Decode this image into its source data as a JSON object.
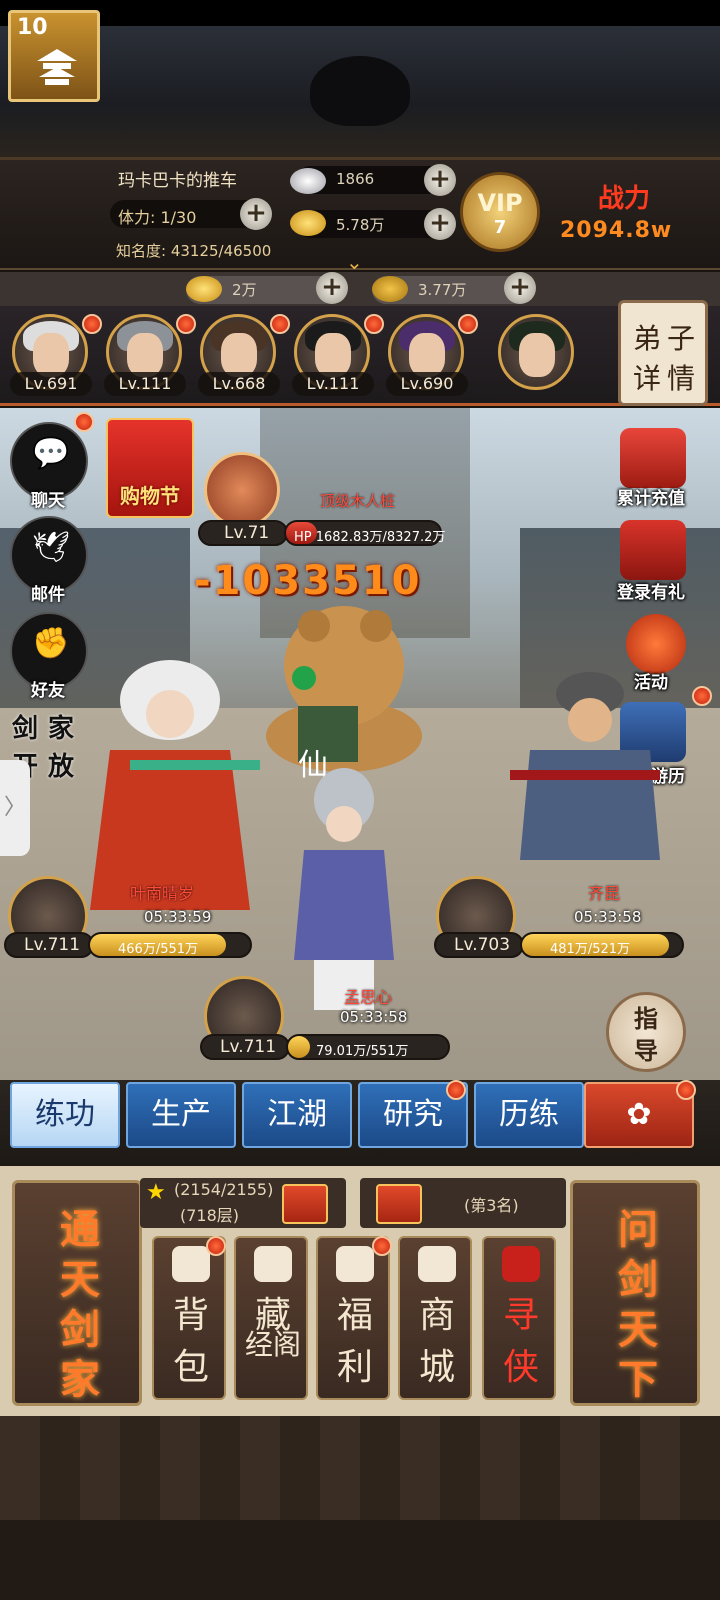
{
  "player": {
    "level": "10",
    "name": "玛卡巴卡的推车",
    "stamina": "体力: 1/30",
    "fame": "知名度: 43125/46500"
  },
  "resources": {
    "silver": "1866",
    "gold": "5.78万",
    "ingot": "2万",
    "bell": "3.77万"
  },
  "vip": {
    "label": "VIP",
    "level": "7"
  },
  "power": {
    "label": "战力",
    "value": "2094.8w"
  },
  "disciples": [
    {
      "level": "Lv.691",
      "hair": "#ddd"
    },
    {
      "level": "Lv.111",
      "hair": "#8d9299"
    },
    {
      "level": "Lv.668",
      "hair": "#4a3426"
    },
    {
      "level": "Lv.111",
      "hair": "#1b1b1b"
    },
    {
      "level": "Lv.690",
      "hair": "#4b2d6b"
    },
    {
      "level": "",
      "hair": "#1e2a1e"
    }
  ],
  "disciple_detail": {
    "c1": "弟",
    "c2": "子",
    "c3": "详",
    "c4": "情"
  },
  "left_menu": {
    "chat": "聊天",
    "mail": "邮件",
    "friends": "好友",
    "sword_banner": [
      "剑",
      "家",
      "开",
      "放"
    ],
    "shop_festival": "购物节"
  },
  "right_menu": {
    "recharge": "累计充值",
    "login_gift": "登录有礼",
    "activity": "活动",
    "shop_travel": "购物游历"
  },
  "enemy": {
    "name": "顶级木人桩",
    "level": "Lv.71",
    "hp_text": "HP 1682.83万/8327.2万",
    "hp_fraction": 0.2,
    "damage": "-1033510"
  },
  "heroes": [
    {
      "name": "叶南晴岁",
      "timer": "05:33:59",
      "level": "Lv.711",
      "hp": "466万/551万",
      "fraction": 0.85
    },
    {
      "name": "孟思心",
      "timer": "05:33:58",
      "level": "Lv.711",
      "hp": "79.01万/551万",
      "fraction": 0.14
    },
    {
      "name": "齐昆",
      "timer": "05:33:58",
      "level": "Lv.703",
      "hp": "481万/521万",
      "fraction": 0.92
    }
  ],
  "toad_badge": "仙",
  "guide": {
    "c1": "指",
    "c2": "导"
  },
  "tabs": [
    "练功",
    "生产",
    "江湖",
    "研究",
    "历练",
    "✿"
  ],
  "panel": {
    "left_big": [
      "通",
      "天",
      "剑",
      "家"
    ],
    "right_big": [
      "问",
      "剑",
      "天",
      "下"
    ],
    "score": "(2154/2155)",
    "floor": "(718层)",
    "rank": "(第3名)",
    "buttons": [
      {
        "t1": "背",
        "t2": "包"
      },
      {
        "t1": "藏",
        "t2": "经阁"
      },
      {
        "t1": "福",
        "t2": "利"
      },
      {
        "t1": "商",
        "t2": "城"
      },
      {
        "t1": "寻",
        "t2": "侠"
      }
    ]
  },
  "colors": {
    "accent": "#d3a24a",
    "tab_blue": "#2f6fb8",
    "damage": "#ff8c1a"
  }
}
